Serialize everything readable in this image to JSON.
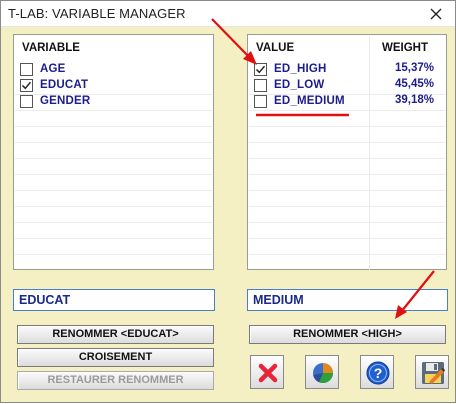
{
  "window": {
    "title": "T-LAB: VARIABLE MANAGER"
  },
  "variables": {
    "header": "VARIABLE",
    "items": [
      {
        "label": "AGE",
        "checked": false
      },
      {
        "label": "EDUCAT",
        "checked": true
      },
      {
        "label": "GENDER",
        "checked": false
      }
    ]
  },
  "values": {
    "header_value": "VALUE",
    "header_weight": "WEIGHT",
    "items": [
      {
        "label": "ED_HIGH",
        "weight": "15,37%",
        "checked": true
      },
      {
        "label": "ED_LOW",
        "weight": "45,45%",
        "checked": false
      },
      {
        "label": "ED_MEDIUM",
        "weight": "39,18%",
        "checked": false
      }
    ]
  },
  "fields": {
    "variable_name": "EDUCAT",
    "value_name": "MEDIUM"
  },
  "buttons": {
    "rename_variable": "RENOMMER <EDUCAT>",
    "crossing": "CROISEMENT",
    "restore_rename": "RESTAURER RENOMMER",
    "rename_value": "RENOMMER <HIGH>"
  },
  "icons": [
    "delete-icon",
    "pie-chart-icon",
    "help-icon",
    "save-icon"
  ],
  "colors": {
    "background": "#f4f0c4",
    "item_text": "#1c1c8c",
    "annotation": "#e01010"
  }
}
